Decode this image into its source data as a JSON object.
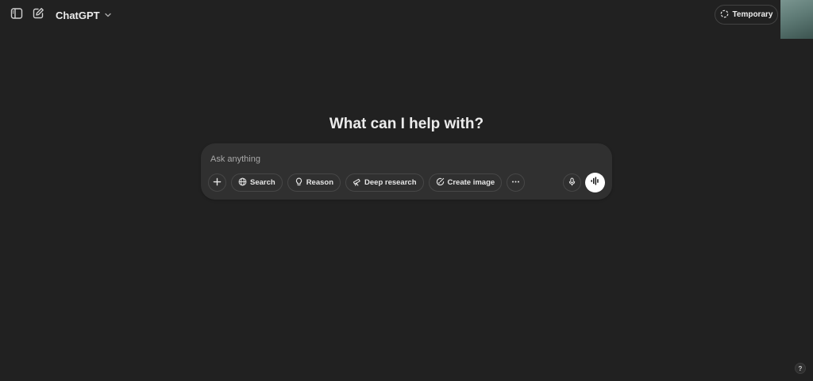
{
  "header": {
    "sidebar_toggle_icon": "sidebar-icon",
    "new_chat_icon": "edit-icon",
    "model_name": "ChatGPT",
    "model_dropdown_icon": "chevron-down-icon",
    "temporary_label": "Temporary",
    "temporary_icon": "dashed-circle-icon"
  },
  "main": {
    "headline": "What can I help with?"
  },
  "composer": {
    "placeholder": "Ask anything",
    "value": "",
    "attach_icon": "plus-icon",
    "tools": [
      {
        "label": "Search",
        "icon": "globe-icon"
      },
      {
        "label": "Reason",
        "icon": "lightbulb-icon"
      },
      {
        "label": "Deep research",
        "icon": "telescope-icon"
      },
      {
        "label": "Create image",
        "icon": "image-brush-icon"
      }
    ],
    "more_icon": "more-horizontal-icon",
    "mic_icon": "microphone-icon",
    "voice_icon": "voice-waveform-icon"
  },
  "footer": {
    "help_label": "?"
  },
  "colors": {
    "background": "#212121",
    "composer": "#303030",
    "pill_border": "#474747",
    "text": "#ececec",
    "placeholder": "#a8a8a8",
    "voice_button": "#ffffff"
  }
}
